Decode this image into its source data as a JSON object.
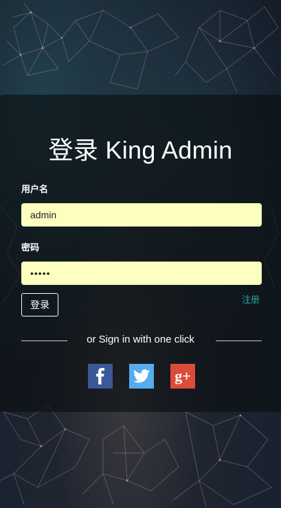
{
  "title": "登录 King Admin",
  "username": {
    "label": "用户名",
    "value": "admin"
  },
  "password": {
    "label": "密码",
    "value": "•••••"
  },
  "login_button": "登录",
  "register_link": "注册",
  "divider_text": "or Sign in with one click",
  "social": [
    {
      "name": "facebook",
      "icon": "facebook-icon",
      "color": "#3b5998"
    },
    {
      "name": "twitter",
      "icon": "twitter-icon",
      "color": "#55acee"
    },
    {
      "name": "google-plus",
      "icon": "google-plus-icon",
      "glyph": "g+",
      "color": "#dd4b39"
    }
  ],
  "colors": {
    "input_bg": "#fdffc0",
    "link": "#2aa3a0",
    "panel": "rgba(10,14,16,0.62)"
  }
}
